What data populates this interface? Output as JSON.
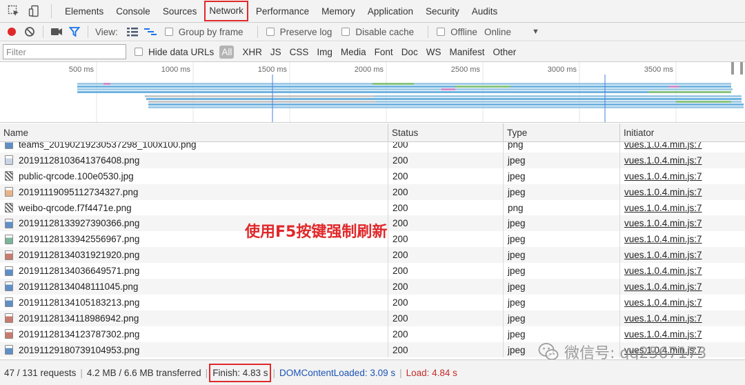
{
  "tabs": [
    {
      "label": "Elements",
      "active": false
    },
    {
      "label": "Console",
      "active": false
    },
    {
      "label": "Sources",
      "active": false
    },
    {
      "label": "Network",
      "active": true
    },
    {
      "label": "Performance",
      "active": false
    },
    {
      "label": "Memory",
      "active": false
    },
    {
      "label": "Application",
      "active": false
    },
    {
      "label": "Security",
      "active": false
    },
    {
      "label": "Audits",
      "active": false
    }
  ],
  "toolbar": {
    "view_label": "View:",
    "group_by_frame": "Group by frame",
    "preserve_log": "Preserve log",
    "disable_cache": "Disable cache",
    "offline": "Offline",
    "throttle": "Online",
    "record_color": "#e0282a",
    "filter_icon_color": "#1a73e8"
  },
  "filter": {
    "placeholder": "Filter",
    "hide_data_urls": "Hide data URLs",
    "types": [
      "All",
      "XHR",
      "JS",
      "CSS",
      "Img",
      "Media",
      "Font",
      "Doc",
      "WS",
      "Manifest",
      "Other"
    ]
  },
  "overview": {
    "ticks": [
      {
        "label": "500 ms",
        "ms": 500
      },
      {
        "label": "1000 ms",
        "ms": 1000
      },
      {
        "label": "1500 ms",
        "ms": 1500
      },
      {
        "label": "2000 ms",
        "ms": 2000
      },
      {
        "label": "2500 ms",
        "ms": 2500
      },
      {
        "label": "3000 ms",
        "ms": 3000
      },
      {
        "label": "3500 ms",
        "ms": 3500
      }
    ]
  },
  "table": {
    "headers": {
      "name": "Name",
      "status": "Status",
      "type": "Type",
      "initiator": "Initiator"
    },
    "rows": [
      {
        "name": "teams_20190219230537298_100x100.png",
        "status": "200",
        "type": "png",
        "initiator": "vues.1.0.4.min.js:7",
        "icon": "blue"
      },
      {
        "name": "20191128103641376408.png",
        "status": "200",
        "type": "jpeg",
        "initiator": "vues.1.0.4.min.js:7",
        "icon": ""
      },
      {
        "name": "public-qrcode.100e0530.jpg",
        "status": "200",
        "type": "jpeg",
        "initiator": "vues.1.0.4.min.js:7",
        "icon": "qr"
      },
      {
        "name": "20191119095112734327.png",
        "status": "200",
        "type": "jpeg",
        "initiator": "vues.1.0.4.min.js:7",
        "icon": "warm"
      },
      {
        "name": "weibo-qrcode.f7f4471e.png",
        "status": "200",
        "type": "png",
        "initiator": "vues.1.0.4.min.js:7",
        "icon": "qr"
      },
      {
        "name": "20191128133927390366.png",
        "status": "200",
        "type": "jpeg",
        "initiator": "vues.1.0.4.min.js:7",
        "icon": "blue"
      },
      {
        "name": "20191128133942556967.png",
        "status": "200",
        "type": "jpeg",
        "initiator": "vues.1.0.4.min.js:7",
        "icon": "green"
      },
      {
        "name": "20191128134031921920.png",
        "status": "200",
        "type": "jpeg",
        "initiator": "vues.1.0.4.min.js:7",
        "icon": "red"
      },
      {
        "name": "20191128134036649571.png",
        "status": "200",
        "type": "jpeg",
        "initiator": "vues.1.0.4.min.js:7",
        "icon": "blue"
      },
      {
        "name": "20191128134048111045.png",
        "status": "200",
        "type": "jpeg",
        "initiator": "vues.1.0.4.min.js:7",
        "icon": "blue"
      },
      {
        "name": "20191128134105183213.png",
        "status": "200",
        "type": "jpeg",
        "initiator": "vues.1.0.4.min.js:7",
        "icon": "blue"
      },
      {
        "name": "20191128134118986942.png",
        "status": "200",
        "type": "jpeg",
        "initiator": "vues.1.0.4.min.js:7",
        "icon": "red"
      },
      {
        "name": "20191128134123787302.png",
        "status": "200",
        "type": "jpeg",
        "initiator": "vues.1.0.4.min.js:7",
        "icon": "red"
      },
      {
        "name": "20191129180739104953.png",
        "status": "200",
        "type": "jpeg",
        "initiator": "vues.1.0.4.min.js:7",
        "icon": "blue"
      }
    ]
  },
  "annotation": "使用F5按键强制刷新",
  "watermark": "微信号: qq2567173",
  "status": {
    "requests": "47 / 131 requests",
    "transferred": "4.2 MB / 6.6 MB transferred",
    "finish": "Finish: 4.83 s",
    "dom_content_loaded": "DOMContentLoaded: 3.09 s",
    "load": "Load: 4.84 s",
    "dcl_color": "#1a53b5",
    "load_color": "#c62a2a"
  }
}
